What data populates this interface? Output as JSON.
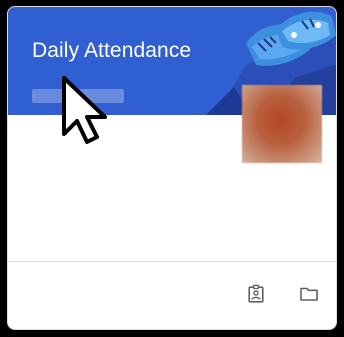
{
  "class_card": {
    "title": "Daily Attendance",
    "section": "",
    "banner_color": "#2f5fd0",
    "banner_theme": "shoes-illustration",
    "avatar": "redacted-profile-photo",
    "footer_actions": [
      {
        "icon": "assignment-ind-icon"
      },
      {
        "icon": "folder-icon"
      }
    ]
  },
  "pointer": {
    "icon": "arrow-cursor-icon"
  }
}
